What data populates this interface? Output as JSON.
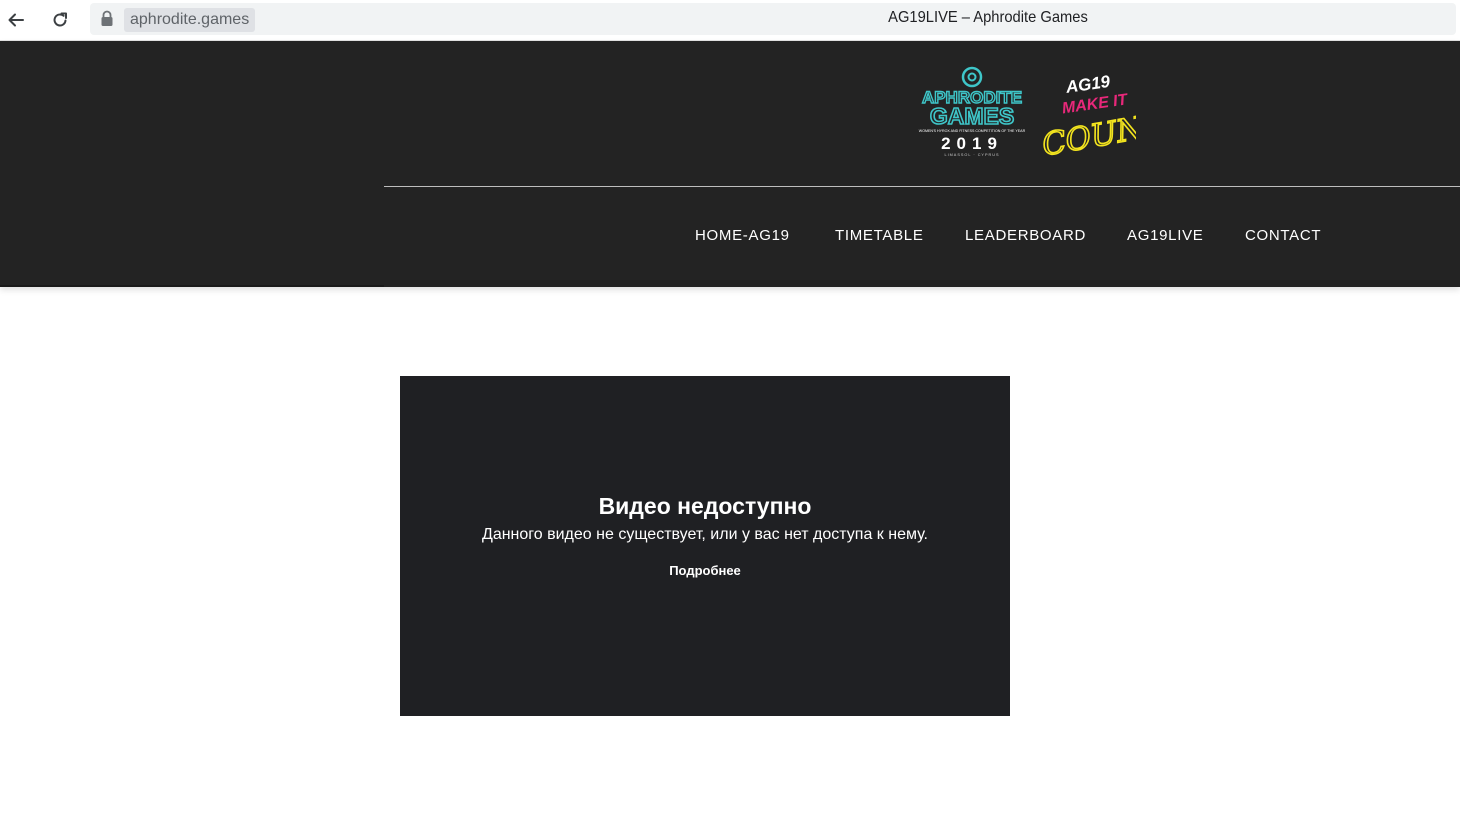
{
  "browser": {
    "url": "aphrodite.games",
    "tab_title": "AG19LIVE – Aphrodite Games",
    "icons": {
      "back": "arrow-left-icon",
      "reload": "reload-icon",
      "secure": "lock-icon"
    }
  },
  "header": {
    "logo_main": {
      "line1": "APHRODITE",
      "line2": "GAMES",
      "year": "2019",
      "tagline": "WOMEN'S HYROX AND FITNESS COMPETITION OF THE YEAR",
      "location": "LIMASSOL · CYPRUS"
    },
    "logo_slogan": {
      "tag": "AG19",
      "line1": "MAKE IT",
      "line2": "COUNT"
    },
    "menu": [
      "HOME-AG19",
      "TIMETABLE",
      "LEADERBOARD",
      "AG19LIVE",
      "CONTACT"
    ]
  },
  "video": {
    "title": "Видео недоступно",
    "message": "Данного видео не существует, или у вас нет доступа к нему.",
    "link": "Подробнее"
  },
  "colors": {
    "header_bg": "#232323",
    "video_bg": "#1f2023",
    "logo_teal": "#3ec6c9",
    "slogan_pink": "#e8287a",
    "slogan_yellow": "#f3e41e"
  }
}
